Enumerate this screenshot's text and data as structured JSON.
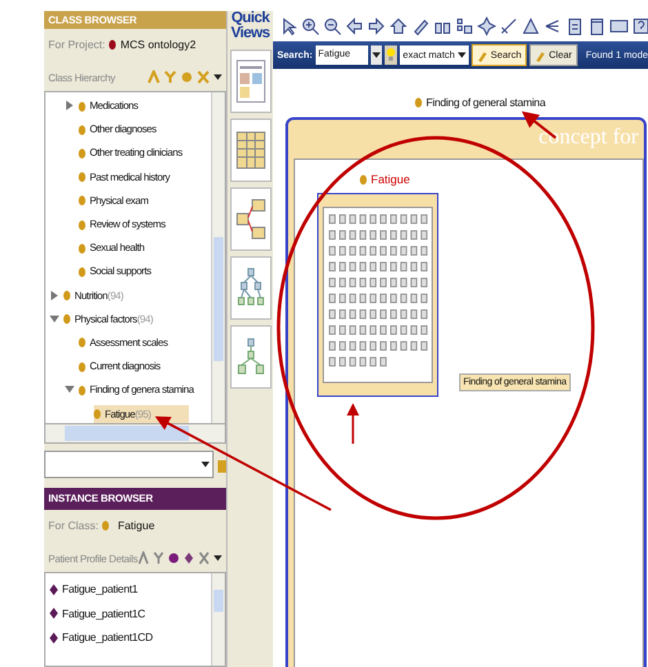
{
  "class_browser": {
    "title": "CLASS BROWSER",
    "project_label": "For Project:",
    "project": "MCS ontology2",
    "hierarchy_label": "Class Hierarchy",
    "tree": [
      {
        "children": [
          {
            "label": "Medications",
            "expanded": false,
            "selected": false
          },
          {
            "label": "Other diagnoses",
            "selected": false
          },
          {
            "label": "Other treating clinicians",
            "selected": false
          },
          {
            "label": "Past medical history",
            "selected": false
          },
          {
            "label": "Physical exam",
            "selected": false
          },
          {
            "label": "Review of systems",
            "selected": false
          },
          {
            "label": "Sexual health",
            "selected": false
          },
          {
            "label": "Social supports",
            "selected": false
          }
        ]
      },
      {
        "label": "Nutrition",
        "count": "(94)",
        "expanded": false,
        "selected": false
      },
      {
        "label": "Physical factors",
        "count": "(94)",
        "expanded": true,
        "selected": false,
        "children": [
          {
            "label": "Assessment scales",
            "selected": false
          },
          {
            "label": "Current diagnosis",
            "selected": false
          },
          {
            "label": "Finding of genera stamina",
            "expanded": true,
            "selected": false,
            "children": [
              {
                "label": "Fatigue",
                "count": "(95)",
                "selected": true
              }
            ]
          }
        ]
      }
    ]
  },
  "instance_browser": {
    "title": "INSTANCE BROWSER",
    "class_label": "For Class:",
    "class": "Fatigue",
    "details_label": "Patient Profile Details",
    "instances": [
      {
        "label": "Fatigue_patient1",
        "selected": false
      },
      {
        "label": "Fatigue_patient1C",
        "selected": false
      },
      {
        "label": "Fatigue_patient1CD",
        "selected": false
      }
    ]
  },
  "quick_views": {
    "title": "Quick Views"
  },
  "search": {
    "label": "Search:",
    "value": "Fatigue",
    "match": "exact match",
    "buttons": [
      "Search",
      "Clear"
    ],
    "result": "Found 1 mode"
  },
  "canvas": {
    "parent": "Finding of general stamina",
    "child": "Fatigue",
    "tooltip": "Finding of general stamina",
    "annotation": "concept for"
  }
}
